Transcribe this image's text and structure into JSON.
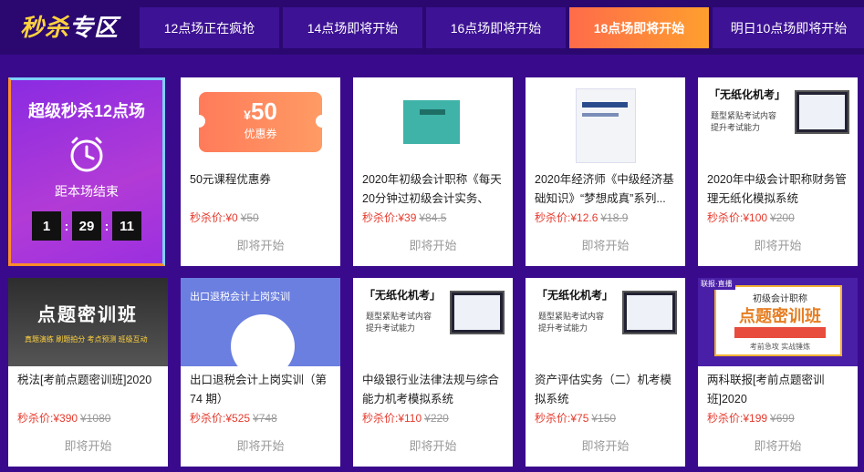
{
  "logo": {
    "part1": "秒杀",
    "part2": "专区"
  },
  "tabs": [
    {
      "label": "12点场正在疯抢"
    },
    {
      "label": "14点场即将开始"
    },
    {
      "label": "16点场即将开始"
    },
    {
      "label": "18点场即将开始",
      "active": true
    },
    {
      "label": "明日10点场即将开始"
    }
  ],
  "timer": {
    "title": "超级秒杀12点场",
    "subtitle": "距本场结束",
    "hours": "1",
    "minutes": "29",
    "seconds": "11"
  },
  "price_prefix": "秒杀价:",
  "status_label": "即将开始",
  "coupon": {
    "symbol": "¥",
    "amount": "50",
    "label": "优惠券"
  },
  "products": [
    {
      "title": "50元课程优惠券",
      "price": "¥0",
      "original": "¥50"
    },
    {
      "title": "2020年初级会计职称《每天20分钟过初级会计实务、经...",
      "price": "¥39",
      "original": "¥84.5"
    },
    {
      "title": "2020年经济师《中级经济基础知识》“梦想成真”系列...",
      "price": "¥12.6",
      "original": "¥18.9"
    },
    {
      "title": "2020年中级会计职称财务管理无纸化模拟系统",
      "price": "¥100",
      "original": "¥200"
    },
    {
      "title": "税法[考前点题密训班]2020",
      "price": "¥390",
      "original": "¥1080"
    },
    {
      "title": "出口退税会计上岗实训（第74 期）",
      "price": "¥525",
      "original": "¥748"
    },
    {
      "title": "中级银行业法律法规与综合能力机考模拟系统",
      "price": "¥110",
      "original": "¥220"
    },
    {
      "title": "资产评估实务（二）机考模拟系统",
      "price": "¥75",
      "original": "¥150"
    },
    {
      "title": "两科联报[考前点题密训班]2020",
      "price": "¥199",
      "original": "¥699"
    }
  ],
  "thumbs": {
    "exam_head": "「无纸化机考」",
    "exam_sub1": "题型紧贴考试内容",
    "exam_sub2": "提升考试能力",
    "dark_big": "点题密训班",
    "dark_tag": "真题演练  刷题拍分  考点预测  班级互动",
    "blue_cap": "出口退税会计上岗实训",
    "gold_corner": "联报·直播",
    "gold_t1": "初级会计职称",
    "gold_t2": "点题密训班",
    "gold_t4": "考前急攻    实战锤炼"
  }
}
